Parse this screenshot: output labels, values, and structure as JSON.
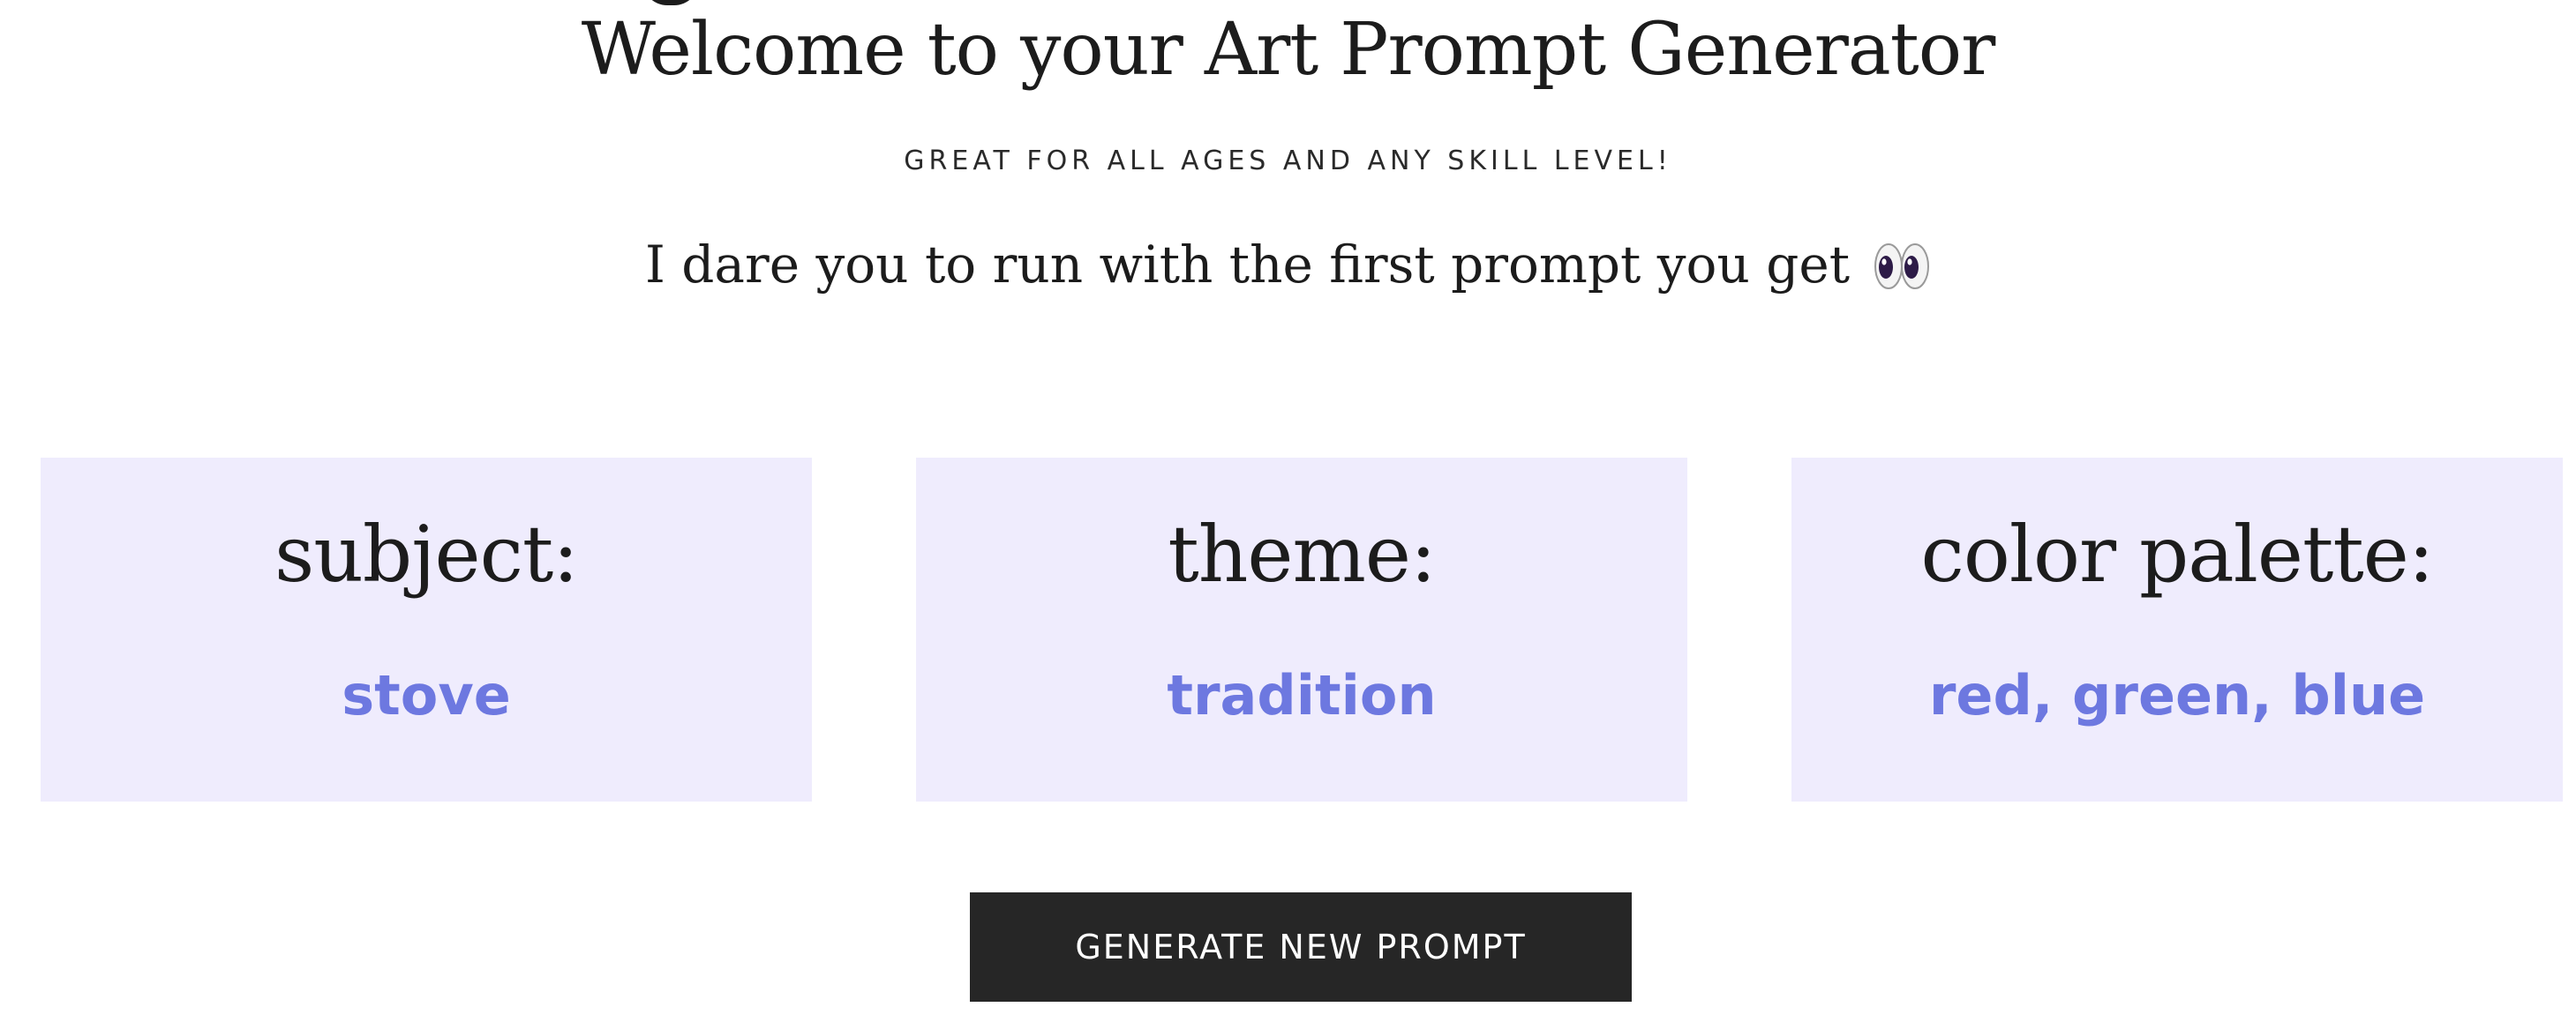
{
  "header": {
    "title": "Welcome to your Art Prompt Generator",
    "tagline": "GREAT FOR ALL AGES AND ANY SKILL LEVEL!",
    "dare_text": "I dare you to run with the first prompt you get",
    "dare_icon": "eyes-icon"
  },
  "cards": [
    {
      "label": "subject:",
      "value": "stove"
    },
    {
      "label": "theme:",
      "value": "tradition"
    },
    {
      "label": "color palette:",
      "value": "red, green, blue"
    }
  ],
  "actions": {
    "generate_label": "GENERATE NEW PROMPT"
  },
  "colors": {
    "card_background": "#efecfd",
    "value_text": "#6d78e0",
    "button_background": "#262626",
    "heading_text": "#1c1c1c"
  }
}
